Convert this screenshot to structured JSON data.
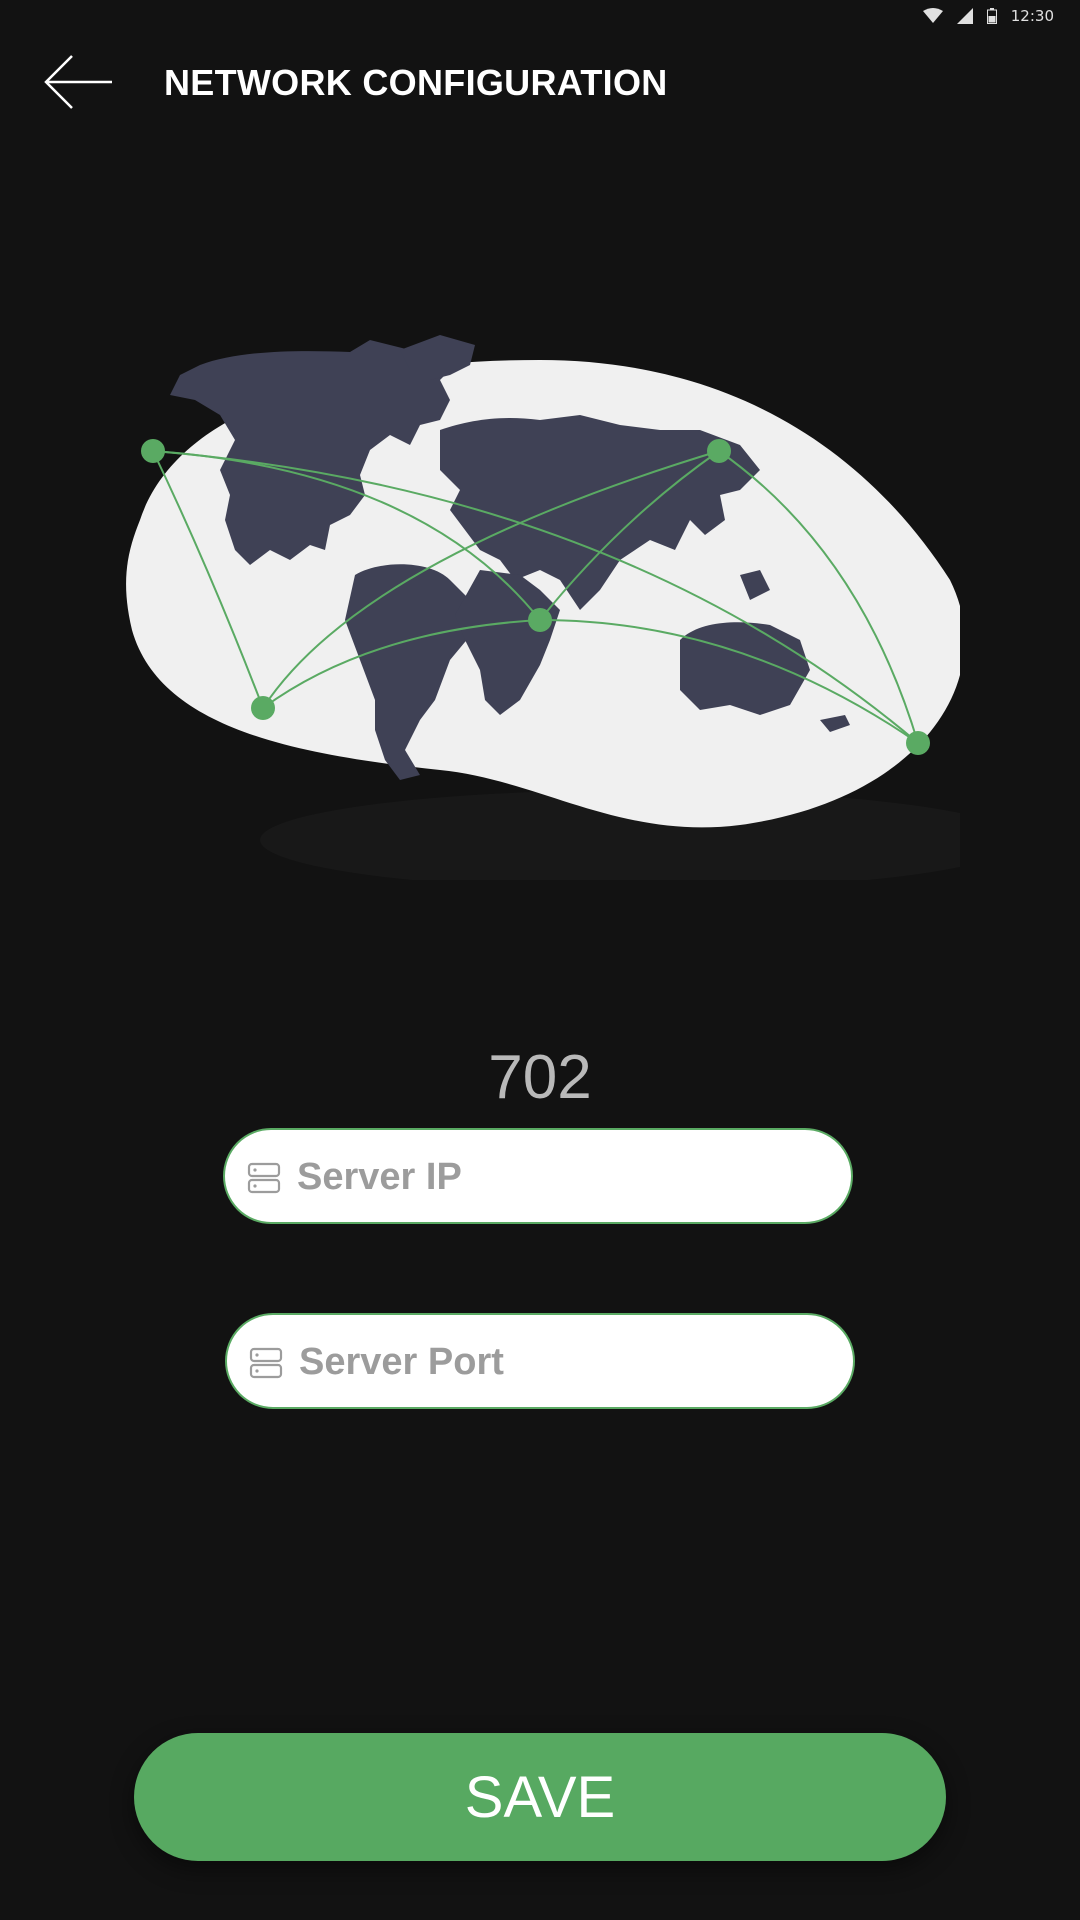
{
  "status_bar": {
    "time": "12:30",
    "icons": [
      "wifi-icon",
      "cell-signal-icon",
      "battery-icon"
    ]
  },
  "header": {
    "title": "NETWORK CONFIGURATION",
    "back_icon": "arrow-left-icon"
  },
  "illustration": {
    "name": "world-network-map",
    "blob_color": "#f0f0f0",
    "land_color": "#3f4155",
    "node_color": "#5aaa63"
  },
  "main": {
    "code": "702",
    "server_ip": {
      "placeholder": "Server IP",
      "value": "",
      "icon": "server-icon"
    },
    "server_port": {
      "placeholder": "Server Port",
      "value": "",
      "icon": "server-icon"
    }
  },
  "footer": {
    "save_label": "SAVE"
  },
  "colors": {
    "background": "#121212",
    "accent": "#57a961",
    "text_primary": "#ffffff",
    "text_muted": "#b9b9b9",
    "placeholder": "#9c9c9c"
  }
}
